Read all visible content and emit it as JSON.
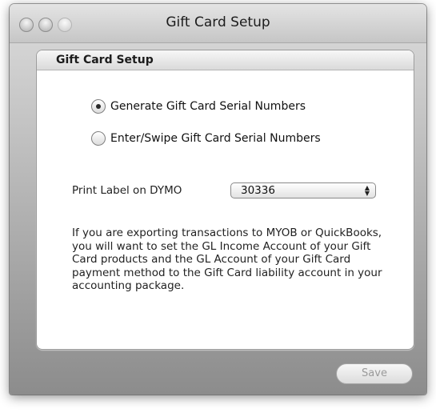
{
  "window": {
    "title": "Gift Card Setup"
  },
  "panel": {
    "header": "Gift Card Setup",
    "options": [
      {
        "label": "Generate Gift Card Serial Numbers",
        "selected": true
      },
      {
        "label": "Enter/Swipe Gift Card Serial Numbers",
        "selected": false
      }
    ],
    "print_label": "Print Label on DYMO",
    "dymo_value": "30336",
    "info_text": "If you are exporting transactions to MYOB or QuickBooks, you will want to set the GL Income Account of your Gift Card products and the GL Account of your Gift Card payment method to the Gift Card liability account in your accounting package."
  },
  "footer": {
    "save_label": "Save",
    "save_enabled": false
  },
  "icons": {
    "close": "close-circle-icon",
    "minimize": "minimize-circle-icon",
    "zoom": "zoom-circle-icon",
    "select_arrows": "up-down-arrows-icon"
  }
}
